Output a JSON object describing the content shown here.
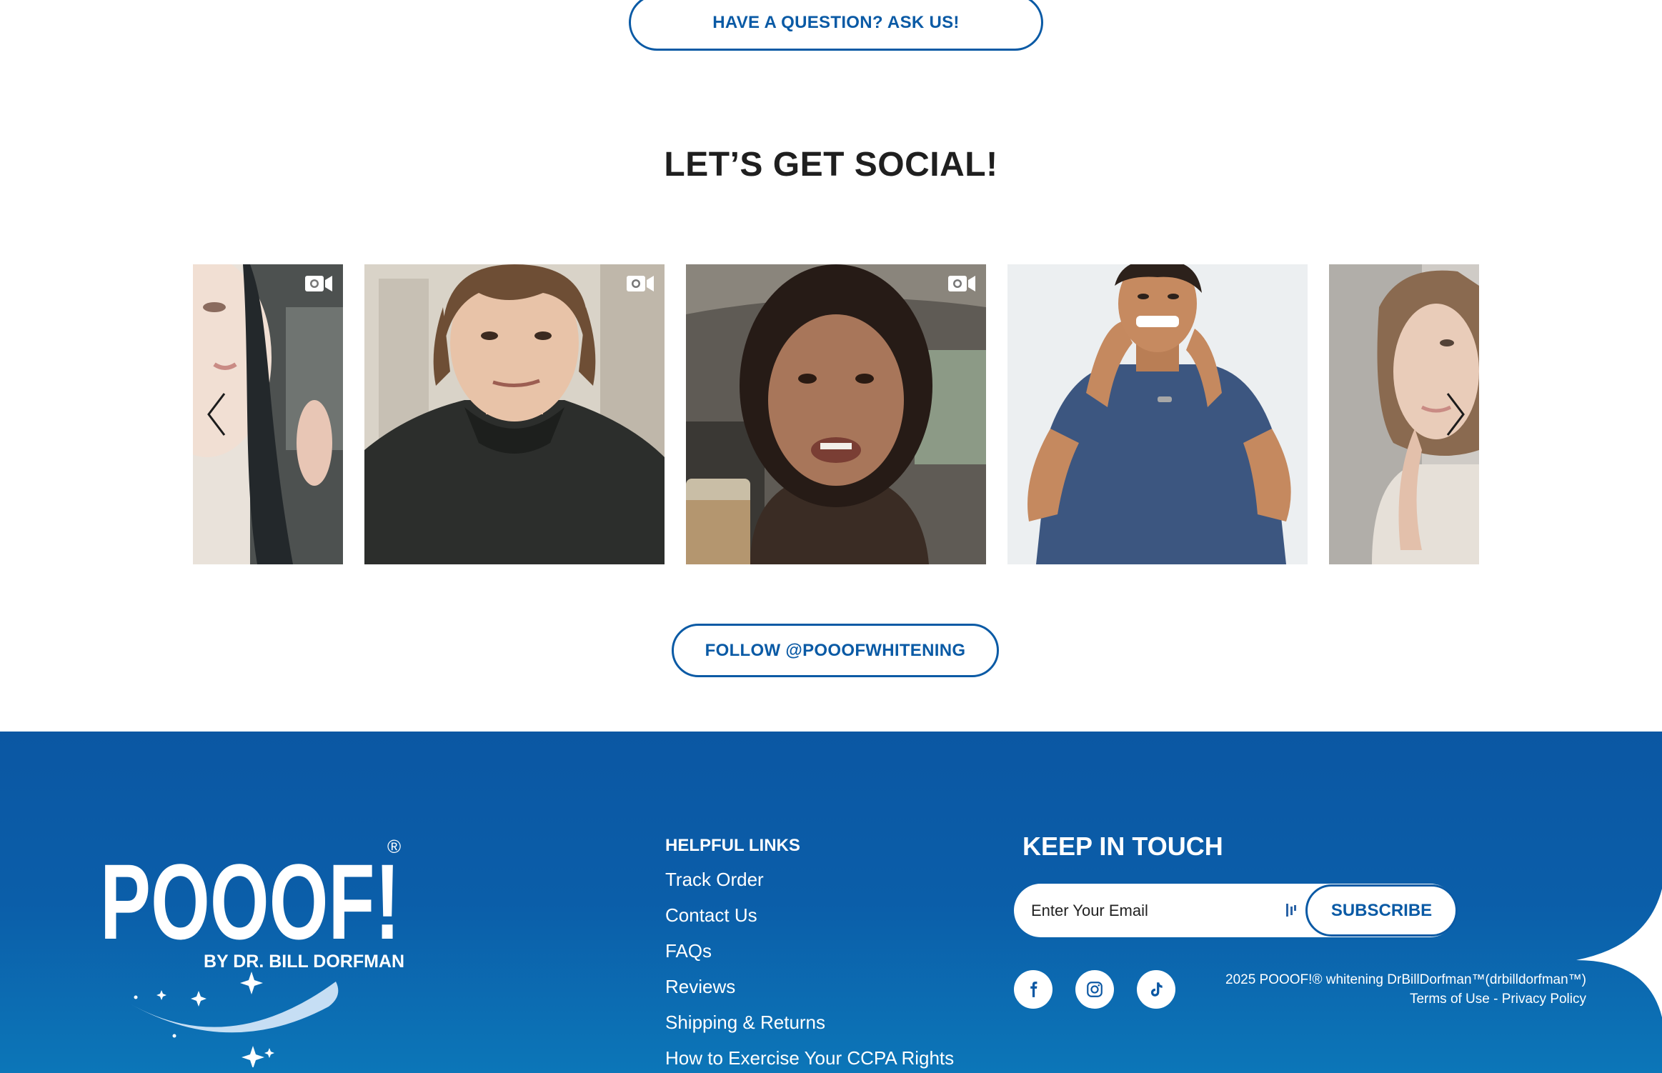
{
  "top": {
    "ask_label": "HAVE A QUESTION? ASK US!"
  },
  "social": {
    "title": "LET’S GET SOCIAL!",
    "follow_label": "FOLLOW @POOOFWHITENING"
  },
  "gallery": {
    "tiles": [
      {
        "icon": "video-icon",
        "subject": "woman-smiling"
      },
      {
        "icon": "video-icon",
        "subject": "man-hoodie"
      },
      {
        "icon": "video-icon",
        "subject": "woman-in-car"
      },
      {
        "icon": "",
        "subject": "man-tray"
      },
      {
        "icon": "",
        "subject": "woman-gray"
      }
    ]
  },
  "footer": {
    "brand": {
      "name": "POOOF!",
      "registered": "®",
      "tagline": "BY DR. BILL DORFMAN"
    },
    "links_heading": "HELPFUL LINKS",
    "links": [
      "Track Order",
      "Contact Us",
      "FAQs",
      "Reviews",
      "Shipping & Returns",
      "How to Exercise Your CCPA Rights"
    ],
    "newsletter": {
      "heading": "KEEP IN TOUCH",
      "placeholder": "Enter Your Email",
      "subscribe_label": "SUBSCRIBE"
    },
    "social_icons": [
      "facebook-icon",
      "instagram-icon",
      "tiktok-icon"
    ],
    "copyright": "2025 POOOF!® whitening DrBillDorfman™(drbilldorfman™)",
    "legal": {
      "terms": "Terms of Use",
      "separator": " - ",
      "privacy": "Privacy Policy"
    }
  },
  "colors": {
    "brand_blue": "#0a5aa5",
    "footer_top": "#0b57a3",
    "footer_bottom": "#0c76b8",
    "heading": "#1f1f1f"
  }
}
